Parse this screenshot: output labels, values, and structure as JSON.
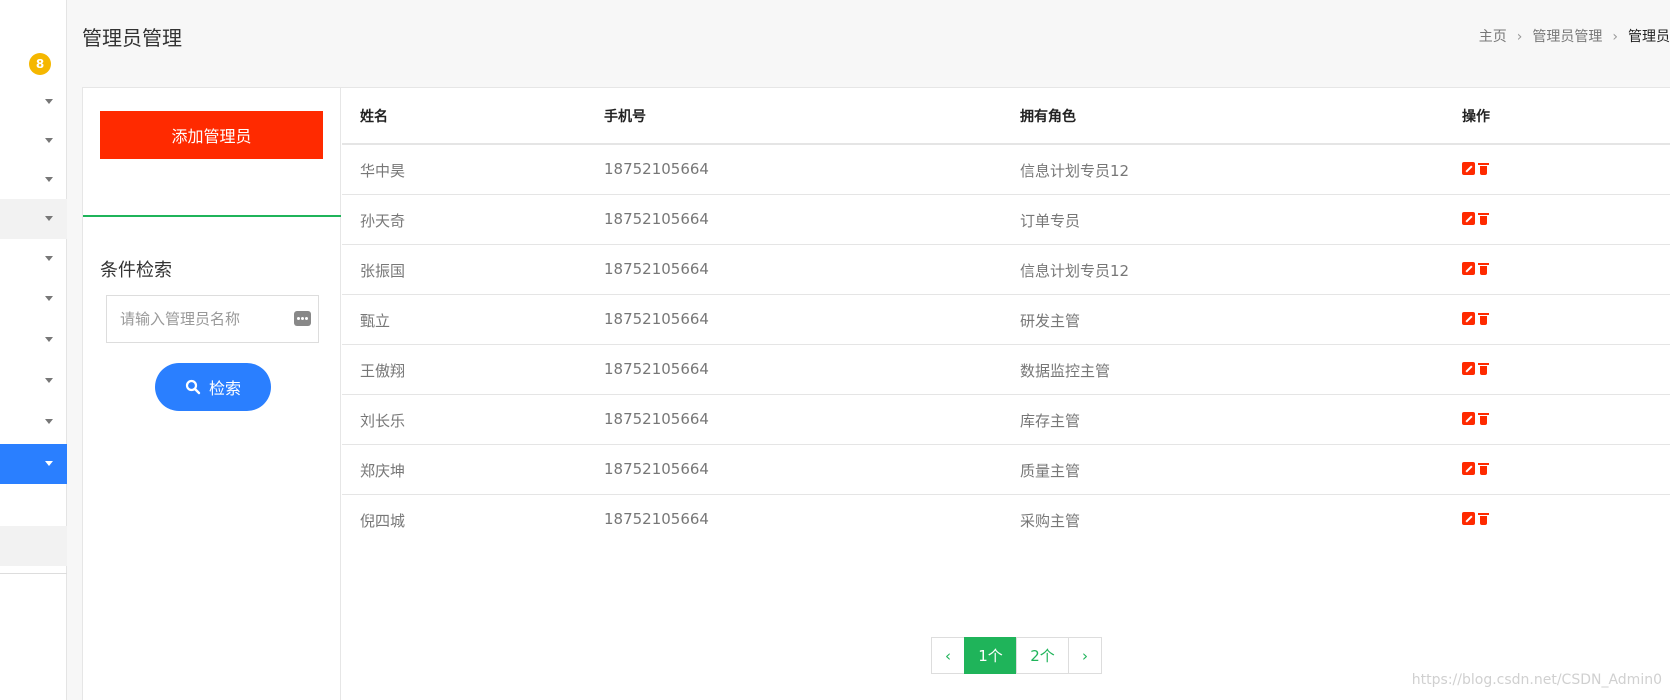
{
  "sidebar": {
    "badge": "8"
  },
  "header": {
    "title": "管理员管理",
    "breadcrumb": [
      "主页",
      "管理员管理",
      "管理员"
    ]
  },
  "left_panel": {
    "add_button": "添加管理员",
    "filter_title": "条件检索",
    "search_placeholder": "请输入管理员名称",
    "search_button": "检索"
  },
  "table": {
    "columns": [
      "姓名",
      "手机号",
      "拥有角色",
      "操作"
    ],
    "rows": [
      {
        "name": "华中昊",
        "phone": "18752105664",
        "role": "信息计划专员12"
      },
      {
        "name": "孙天奇",
        "phone": "18752105664",
        "role": "订单专员"
      },
      {
        "name": "张振国",
        "phone": "18752105664",
        "role": "信息计划专员12"
      },
      {
        "name": "甄立",
        "phone": "18752105664",
        "role": "研发主管"
      },
      {
        "name": "王傲翔",
        "phone": "18752105664",
        "role": "数据监控主管"
      },
      {
        "name": "刘长乐",
        "phone": "18752105664",
        "role": "库存主管"
      },
      {
        "name": "郑庆坤",
        "phone": "18752105664",
        "role": "质量主管"
      },
      {
        "name": "倪四城",
        "phone": "18752105664",
        "role": "采购主管"
      }
    ]
  },
  "pagination": {
    "prev": "‹",
    "pages": [
      "1个",
      "2个"
    ],
    "current": "1个",
    "next": "›"
  },
  "watermark": "https://blog.csdn.net/CSDN_Admin0",
  "colors": {
    "primary_blue": "#2a7fff",
    "danger_red": "#ff2a00",
    "success_green": "#1fb45a",
    "badge_yellow": "#f5b700"
  }
}
